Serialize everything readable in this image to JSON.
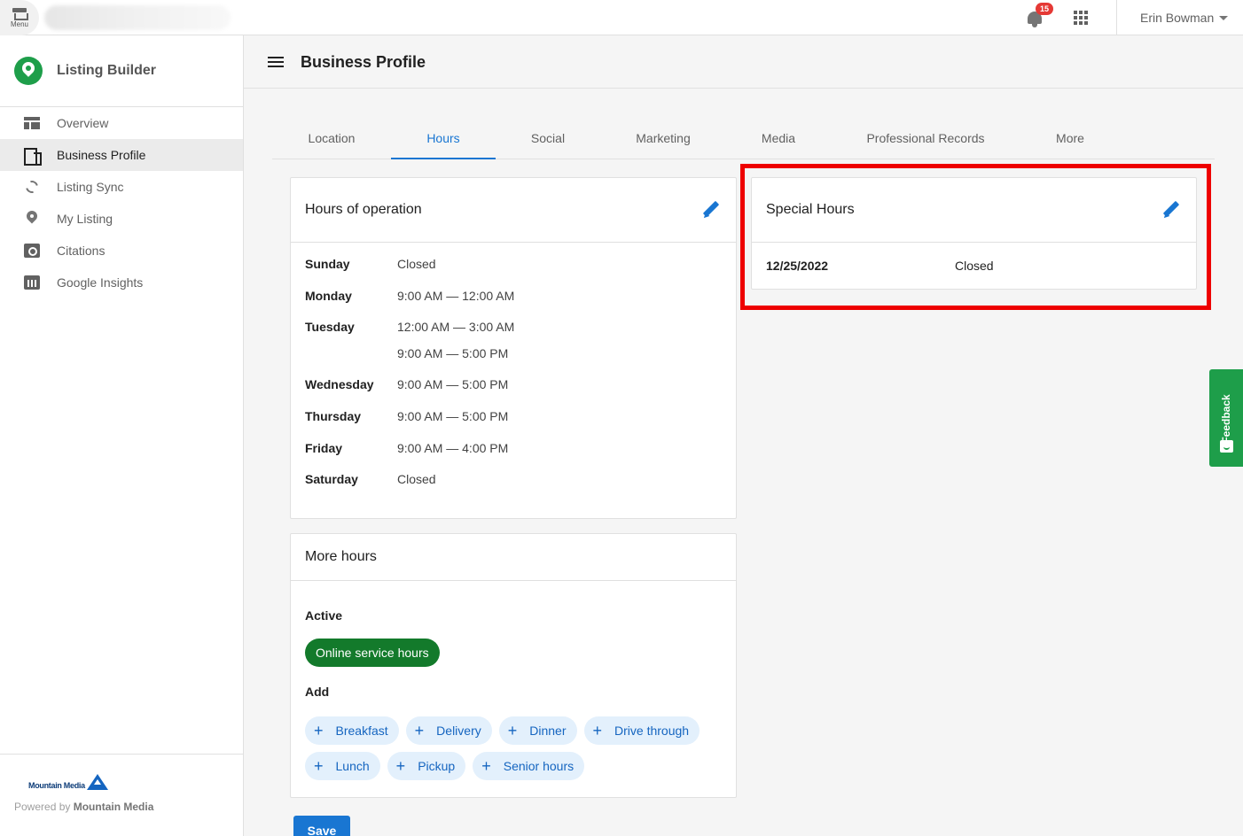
{
  "topbar": {
    "menu_label": "Menu",
    "notification_count": "15",
    "user_name": "Erin Bowman"
  },
  "sidebar": {
    "brand": "Listing Builder",
    "items": [
      {
        "label": "Overview",
        "icon": "overview-icon"
      },
      {
        "label": "Business Profile",
        "icon": "building-icon",
        "active": true
      },
      {
        "label": "Listing Sync",
        "icon": "sync-icon"
      },
      {
        "label": "My Listing",
        "icon": "location-pin-icon"
      },
      {
        "label": "Citations",
        "icon": "citation-search-icon"
      },
      {
        "label": "Google Insights",
        "icon": "bar-chart-icon"
      }
    ],
    "footer": {
      "logo_text": "Mountain Media",
      "powered_prefix": "Powered by",
      "powered_company": "Mountain Media"
    }
  },
  "header": {
    "title": "Business Profile"
  },
  "tabs": [
    "Location",
    "Hours",
    "Social",
    "Marketing",
    "Media",
    "Professional Records",
    "More"
  ],
  "active_tab": "Hours",
  "hours_card": {
    "title": "Hours of operation",
    "rows": [
      {
        "day": "Sunday",
        "times": [
          "Closed"
        ]
      },
      {
        "day": "Monday",
        "times": [
          "9:00 AM — 12:00 AM"
        ]
      },
      {
        "day": "Tuesday",
        "times": [
          "12:00 AM — 3:00 AM",
          "9:00 AM — 5:00 PM"
        ]
      },
      {
        "day": "Wednesday",
        "times": [
          "9:00 AM — 5:00 PM"
        ]
      },
      {
        "day": "Thursday",
        "times": [
          "9:00 AM — 5:00 PM"
        ]
      },
      {
        "day": "Friday",
        "times": [
          "9:00 AM — 4:00 PM"
        ]
      },
      {
        "day": "Saturday",
        "times": [
          "Closed"
        ]
      }
    ]
  },
  "more_hours": {
    "title": "More hours",
    "active_label": "Active",
    "active_chips": [
      "Online service hours"
    ],
    "add_label": "Add",
    "add_chips": [
      "Breakfast",
      "Delivery",
      "Dinner",
      "Drive through",
      "Lunch",
      "Pickup",
      "Senior hours"
    ]
  },
  "special_hours": {
    "title": "Special Hours",
    "rows": [
      {
        "date": "12/25/2022",
        "status": "Closed"
      }
    ]
  },
  "save_label": "Save",
  "feedback_label": "Feedback",
  "colors": {
    "accent": "#1976d2",
    "brand_green": "#1e9e4a",
    "active_chip": "#137a2b",
    "highlight": "#ee0000"
  }
}
